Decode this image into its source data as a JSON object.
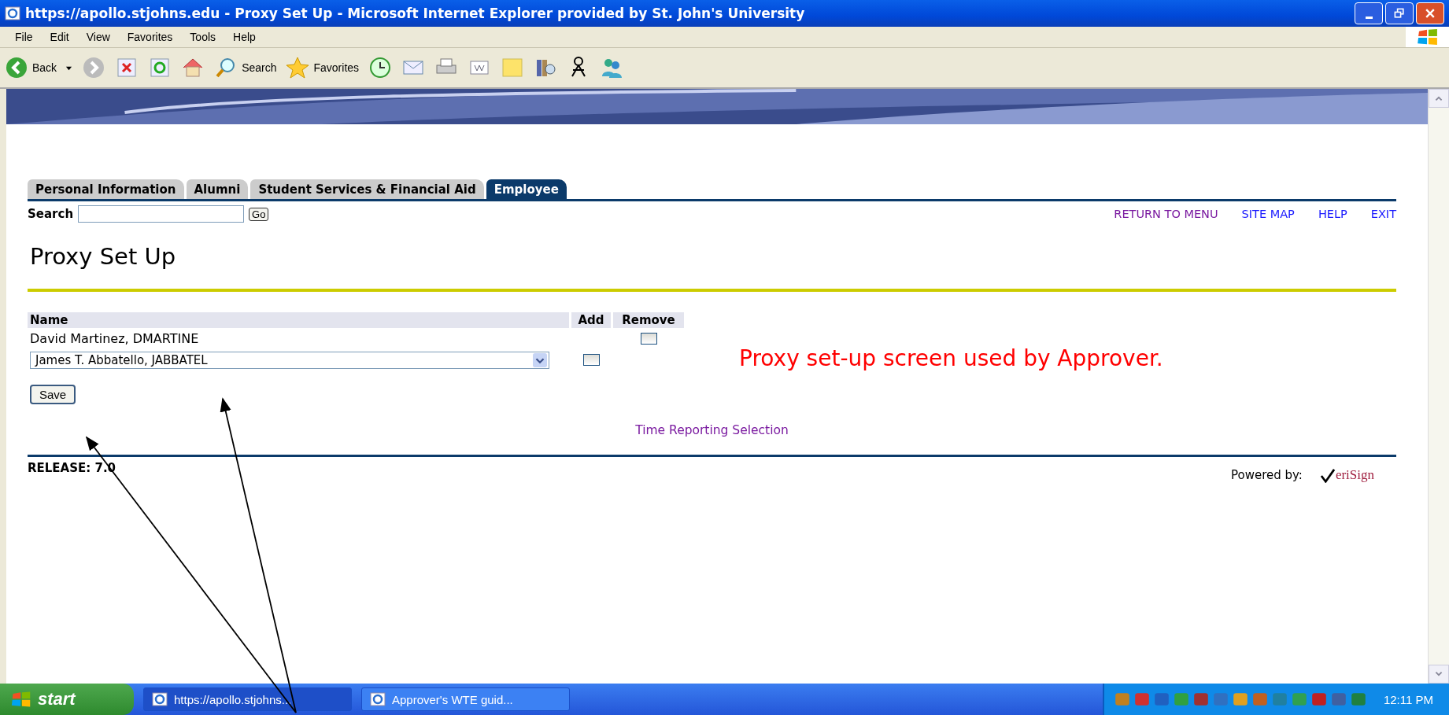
{
  "window": {
    "title": "https://apollo.stjohns.edu - Proxy Set Up - Microsoft Internet Explorer provided by St. John's University"
  },
  "menu": [
    "File",
    "Edit",
    "View",
    "Favorites",
    "Tools",
    "Help"
  ],
  "toolbar": {
    "back": "Back",
    "search": "Search",
    "favorites": "Favorites"
  },
  "tabs": [
    {
      "label": "Personal Information",
      "selected": false
    },
    {
      "label": "Alumni",
      "selected": false
    },
    {
      "label": "Student Services & Financial Aid",
      "selected": false
    },
    {
      "label": "Employee",
      "selected": true
    }
  ],
  "search": {
    "label": "Search",
    "button": "Go"
  },
  "links": [
    {
      "label": "RETURN TO MENU",
      "visited": true
    },
    {
      "label": "SITE MAP",
      "visited": false
    },
    {
      "label": "HELP",
      "visited": false
    },
    {
      "label": "EXIT",
      "visited": false
    }
  ],
  "page_title": "Proxy Set Up",
  "table": {
    "columns": [
      "Name",
      "Add",
      "Remove"
    ],
    "rows": [
      {
        "kind": "text",
        "name": "David Martinez, DMARTINE",
        "remove_checked": false
      },
      {
        "kind": "select",
        "name": "James T. Abbatello, JABBATEL",
        "add_checked": false
      }
    ]
  },
  "save_button": "Save",
  "annotation": "Proxy set-up screen used by Approver.",
  "footer_link": {
    "label": "Time Reporting Selection",
    "visited": true
  },
  "release": "RELEASE: 7.0",
  "powered_by": "Powered by:",
  "logo_text": "eriSign",
  "taskbar": {
    "start": "start",
    "tasks": [
      {
        "label": "https://apollo.stjohns...",
        "selected": true
      },
      {
        "label": "Approver's WTE guid...",
        "selected": false
      }
    ],
    "clock": "12:11 PM"
  }
}
